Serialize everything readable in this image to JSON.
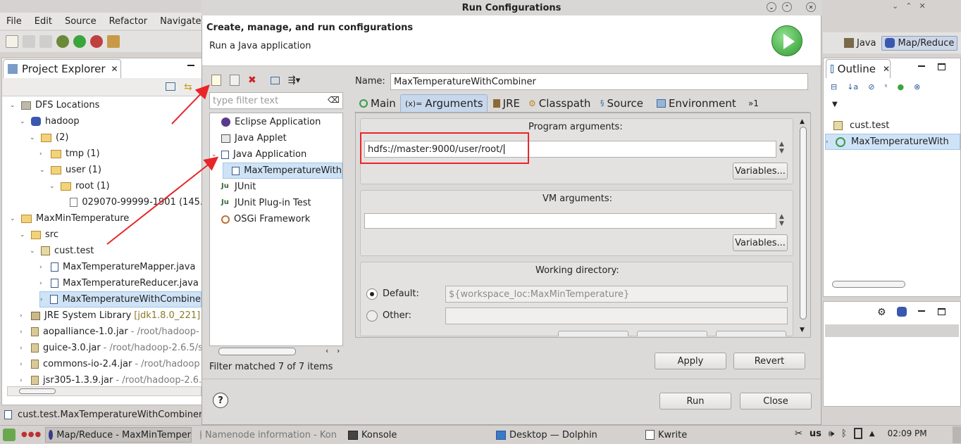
{
  "eclipse": {
    "menu": [
      "File",
      "Edit",
      "Source",
      "Refactor",
      "Navigate"
    ],
    "perspectives": [
      "Java",
      "Map/Reduce"
    ],
    "project_explorer": {
      "title": "Project Explorer",
      "rows": [
        {
          "text": "DFS Locations",
          "extra": ""
        },
        {
          "text": "hadoop",
          "extra": ""
        },
        {
          "text": "(2)",
          "extra": ""
        },
        {
          "text": "tmp (1)",
          "extra": ""
        },
        {
          "text": "user (1)",
          "extra": ""
        },
        {
          "text": "root (1)",
          "extra": ""
        },
        {
          "text": "029070-99999-1901 (145.",
          "extra": ""
        },
        {
          "text": "MaxMinTemperature",
          "extra": ""
        },
        {
          "text": "src",
          "extra": ""
        },
        {
          "text": "cust.test",
          "extra": ""
        },
        {
          "text": "MaxTemperatureMapper.java",
          "extra": ""
        },
        {
          "text": "MaxTemperatureReducer.java",
          "extra": ""
        },
        {
          "text": "MaxTemperatureWithCombine",
          "extra": ""
        },
        {
          "text": "JRE System Library",
          "extra": "[jdk1.8.0_221]"
        },
        {
          "text": "aopalliance-1.0.jar",
          "extra": "- /root/hadoop-"
        },
        {
          "text": "guice-3.0.jar",
          "extra": "- /root/hadoop-2.6.5/s"
        },
        {
          "text": "commons-io-2.4.jar",
          "extra": "- /root/hadoop"
        },
        {
          "text": "jsr305-1.3.9.jar",
          "extra": "- /root/hadoop-2.6."
        }
      ]
    },
    "status_text": "cust.test.MaxTemperatureWithCombiner",
    "outline": {
      "title": "Outline",
      "rows": [
        "cust.test",
        "MaxTemperatureWith"
      ]
    }
  },
  "dialog": {
    "title": "Run Configurations",
    "header_title": "Create, manage, and run configurations",
    "header_subtitle": "Run a Java application",
    "filter_placeholder": "type filter text",
    "config_tree": [
      "Eclipse Application",
      "Java Applet",
      "Java Application",
      "MaxTemperatureWith",
      "JUnit",
      "JUnit Plug-in Test",
      "OSGi Framework"
    ],
    "filter_status": "Filter matched 7 of 7 items",
    "name_label": "Name:",
    "name_value": "MaxTemperatureWithCombiner",
    "tabs": [
      "Main",
      "Arguments",
      "JRE",
      "Classpath",
      "Source",
      "Environment"
    ],
    "tabs_more": "»1",
    "program_args_label": "Program arguments:",
    "program_args_value": "hdfs://master:9000/user/root/",
    "variables_label": "Variables...",
    "vm_args_label": "VM arguments:",
    "vm_args_value": "",
    "working_dir_label": "Working directory:",
    "default_label": "Default:",
    "default_value": "${workspace_loc:MaxMinTemperature}",
    "other_label": "Other:",
    "apply_label": "Apply",
    "revert_label": "Revert",
    "run_label": "Run",
    "close_label": "Close",
    "help_label": "?"
  },
  "taskbar": {
    "tasks": [
      "Map/Reduce - MaxMinTemper",
      "Namenode information - Kon",
      "Konsole",
      "Desktop — Dolphin",
      "Kwrite"
    ],
    "keyboard": "us",
    "clock": "02:09 PM"
  },
  "colors": {
    "accent_red": "#e8262a",
    "selection": "#cfe3f6",
    "run_green": "#3aa53a"
  }
}
